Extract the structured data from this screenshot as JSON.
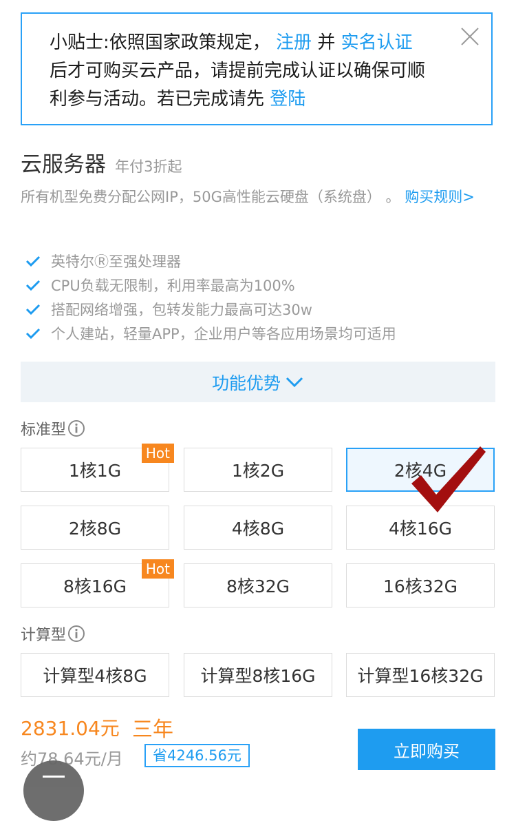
{
  "tip": {
    "text_prefix": "小贴士:依照国家政策规定，",
    "link_register": "注册",
    "and": "并",
    "link_realname_1": "实名认",
    "link_realname_2": "证",
    "text_mid": "后才可购买云产品，请提前完成认证以确保可顺利参与活动。若已完成请先",
    "link_login": "登陆"
  },
  "product": {
    "title": "云服务器",
    "subtitle": "年付3折起",
    "desc": "所有机型免费分配公网IP，50G高性能云硬盘（系统盘） 。",
    "rules_link": "购买规则>"
  },
  "features": [
    "英特尔Ⓡ至强处理器",
    "CPU负载无限制，利用率最高为100%",
    "搭配网络增强，包转发能力最高可达30w",
    "个人建站，轻量APP，企业用户等各应用场景均可适用"
  ],
  "advantages_label": "功能优势",
  "standard": {
    "label": "标准型",
    "options": [
      {
        "label": "1核1G",
        "hot": "Hot"
      },
      {
        "label": "1核2G"
      },
      {
        "label": "2核4G",
        "selected": true
      },
      {
        "label": "2核8G"
      },
      {
        "label": "4核8G"
      },
      {
        "label": "4核16G"
      },
      {
        "label": "8核16G",
        "hot": "Hot"
      },
      {
        "label": "8核32G"
      },
      {
        "label": "16核32G"
      }
    ]
  },
  "compute": {
    "label": "计算型",
    "options": [
      {
        "label": "计算型4核8G"
      },
      {
        "label": "计算型8核16G"
      },
      {
        "label": "计算型16核32G"
      }
    ]
  },
  "price": {
    "total": "2831.04元",
    "term": "三年",
    "monthly": "约78.64元/月",
    "saving": "省4246.56元"
  },
  "buy_button": "立即购买",
  "colors": {
    "accent": "#1e9cf0",
    "orange": "#f7871f",
    "check": "#a30f0f"
  }
}
